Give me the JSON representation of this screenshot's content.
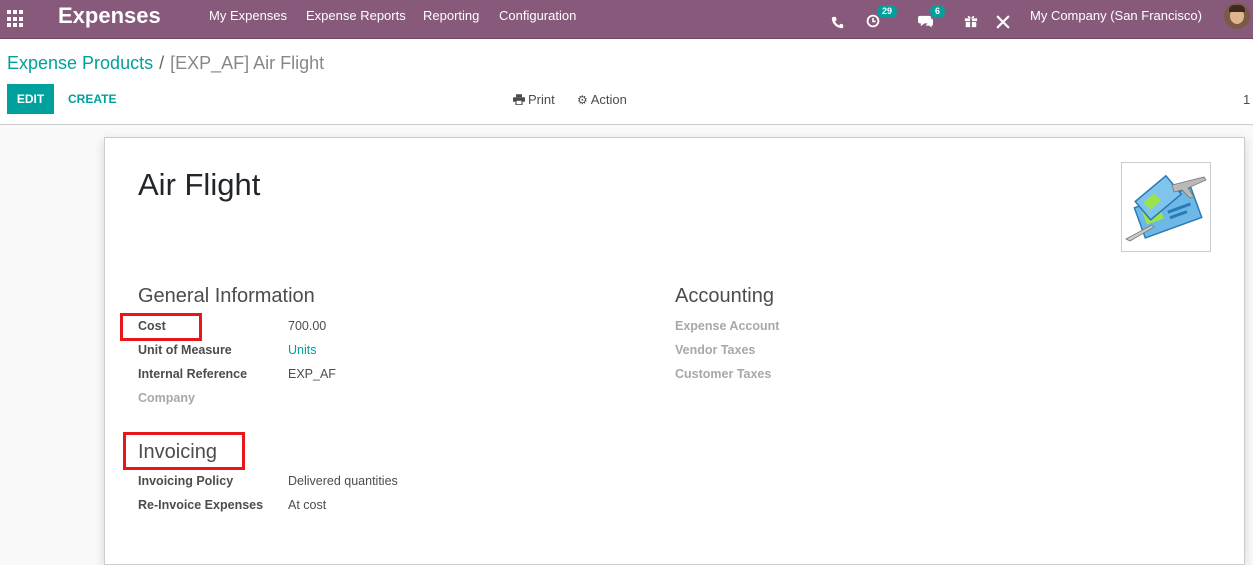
{
  "app": {
    "title": "Expenses"
  },
  "nav": {
    "menu": [
      "My Expenses",
      "Expense Reports",
      "Reporting",
      "Configuration"
    ],
    "activity_count": "29",
    "message_count": "6",
    "company": "My Company (San Francisco)"
  },
  "icons": {
    "apps": "apps-grid-icon",
    "phone": "phone-icon",
    "activity": "clock-icon",
    "messages": "chat-icon",
    "gift": "gift-icon",
    "debug": "tools-icon",
    "print": "print-icon",
    "action": "gear-icon"
  },
  "breadcrumb": {
    "parent": "Expense Products",
    "separator": "/",
    "current": "[EXP_AF] Air Flight"
  },
  "buttons": {
    "edit": "EDIT",
    "create": "CREATE",
    "print": "Print",
    "action": "Action"
  },
  "pager": {
    "value": "1"
  },
  "record": {
    "name": "Air Flight",
    "general": {
      "heading": "General Information",
      "cost_label": "Cost",
      "cost": "700.00",
      "uom_label": "Unit of Measure",
      "uom": "Units",
      "ref_label": "Internal Reference",
      "ref": "EXP_AF",
      "company_label": "Company"
    },
    "accounting": {
      "heading": "Accounting",
      "expense_account": "Expense Account",
      "vendor_taxes": "Vendor Taxes",
      "customer_taxes": "Customer Taxes"
    },
    "invoicing": {
      "heading": "Invoicing",
      "policy_label": "Invoicing Policy",
      "policy": "Delivered quantities",
      "reinvoice_label": "Re-Invoice Expenses",
      "reinvoice": "At cost"
    }
  },
  "colors": {
    "brand": "#875a7b",
    "accent": "#00a09d",
    "highlight": "#e8161b"
  }
}
